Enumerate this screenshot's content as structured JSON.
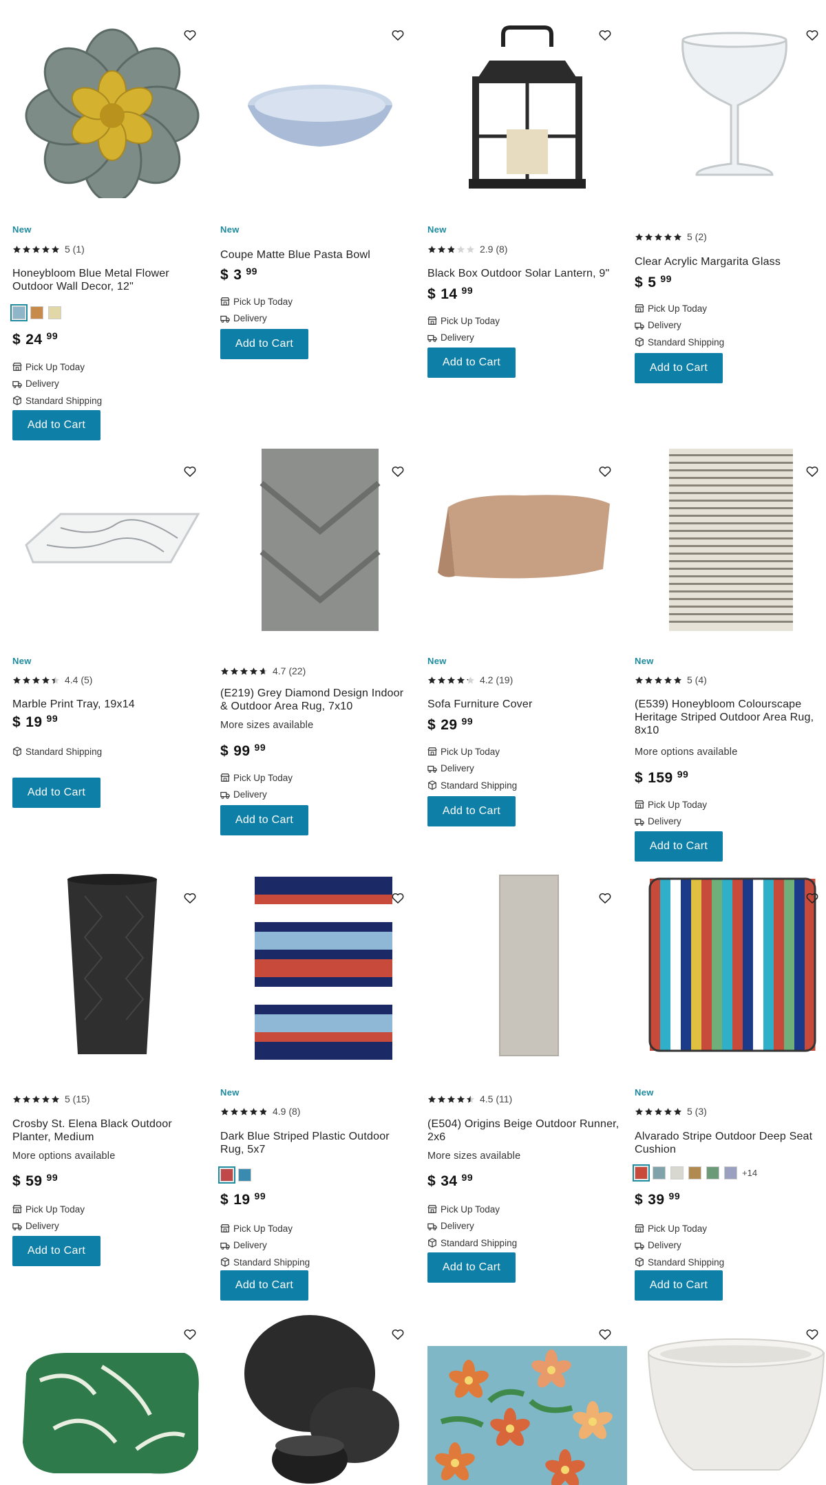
{
  "ui": {
    "new_badge": "New",
    "add_to_cart": "Add to Cart",
    "pickup": "Pick Up Today",
    "delivery": "Delivery",
    "shipping": "Standard Shipping",
    "currency": "$",
    "accent": "#0e7fa6",
    "badge_color": "#1d8a9e"
  },
  "products": [
    {
      "title": "Honeybloom Blue Metal Flower Outdoor Wall Decor, 12\"",
      "rating_text": "5 (1)",
      "rating": 5,
      "price_dollars": "24",
      "price_cents": "99",
      "swatch_colors": [
        "#8fb6c8",
        "#c88a4a",
        "#e2d7a6"
      ],
      "image": "flower"
    },
    {
      "title": "Coupe Matte Blue Pasta Bowl",
      "price_dollars": "3",
      "price_cents": "99",
      "image": "bowl"
    },
    {
      "title": "Black Box Outdoor Solar Lantern, 9\"",
      "rating_text": "2.9 (8)",
      "rating": 2.9,
      "price_dollars": "14",
      "price_cents": "99",
      "image": "lantern"
    },
    {
      "title": "Clear Acrylic Margarita Glass",
      "rating_text": "5 (2)",
      "rating": 5,
      "price_dollars": "5",
      "price_cents": "99",
      "image": "glass"
    },
    {
      "title": "Marble Print Tray, 19x14",
      "rating_text": "4.4 (5)",
      "rating": 4.4,
      "price_dollars": "19",
      "price_cents": "99",
      "image": "tray"
    },
    {
      "title": "(E219) Grey Diamond Design Indoor & Outdoor Area Rug, 7x10",
      "rating_text": "4.7 (22)",
      "rating": 4.7,
      "note": "More sizes available",
      "price_dollars": "99",
      "price_cents": "99",
      "image": "greyrug"
    },
    {
      "title": "Sofa Furniture Cover",
      "rating_text": "4.2 (19)",
      "rating": 4.2,
      "price_dollars": "29",
      "price_cents": "99",
      "image": "cover"
    },
    {
      "title": "(E539) Honeybloom Colourscape Heritage Striped Outdoor Area Rug, 8x10",
      "rating_text": "5 (4)",
      "rating": 5,
      "note": "More options available",
      "price_dollars": "159",
      "price_cents": "99",
      "image": "striperug"
    },
    {
      "title": "Crosby St. Elena Black Outdoor Planter, Medium",
      "rating_text": "5 (15)",
      "rating": 5,
      "note": "More options available",
      "price_dollars": "59",
      "price_cents": "99",
      "image": "planter"
    },
    {
      "title": "Dark Blue Striped Plastic Outdoor Rug, 5x7",
      "rating_text": "4.9 (8)",
      "rating": 4.9,
      "price_dollars": "19",
      "price_cents": "99",
      "swatch_colors": [
        "#c04848",
        "#3a8bb0"
      ],
      "image": "bluerug"
    },
    {
      "title": "(E504) Origins Beige Outdoor Runner, 2x6",
      "rating_text": "4.5 (11)",
      "rating": 4.5,
      "note": "More sizes available",
      "price_dollars": "34",
      "price_cents": "99",
      "image": "runner"
    },
    {
      "title": "Alvarado Stripe Outdoor Deep Seat Cushion",
      "rating_text": "5 (3)",
      "rating": 5,
      "price_dollars": "39",
      "price_cents": "99",
      "swatch_colors": [
        "#c84a3a",
        "#7fa3a8",
        "#d8d8d0",
        "#b08a50",
        "#6a9a78",
        "#9aa0c0"
      ],
      "swatch_more": "+14",
      "image": "cushion"
    },
    {
      "image": "leafcushion"
    },
    {
      "image": "dishes"
    },
    {
      "image": "floralrug"
    },
    {
      "image": "whitepot"
    }
  ]
}
